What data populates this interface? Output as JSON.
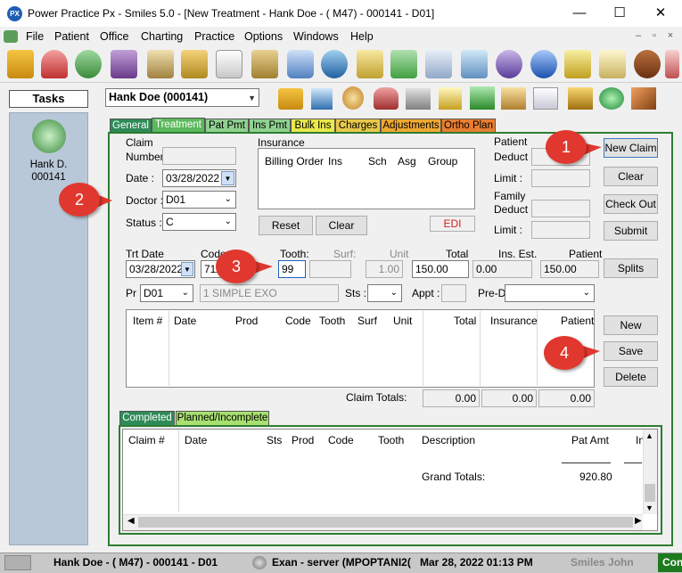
{
  "window": {
    "title": "Power Practice Px - Smiles 5.0 - [New Treatment - Hank Doe - ( M47) - 000141 - D01]",
    "app_icon_text": "PX",
    "min": "—",
    "max": "☐",
    "close": "✕"
  },
  "menu": [
    "File",
    "Patient",
    "Office",
    "Charting",
    "Practice",
    "Options",
    "Windows",
    "Help"
  ],
  "mdi_controls": [
    "–",
    "▫",
    "×"
  ],
  "tasks": {
    "title": "Tasks",
    "item_name": "Hank D.",
    "item_id": "000141"
  },
  "patient_select": {
    "value": "Hank Doe (000141)"
  },
  "tabs": [
    {
      "label": "General",
      "bg": "#2e8b57",
      "fg": "#ffffff"
    },
    {
      "label": "Treatment",
      "bg": "#5cb85c",
      "fg": "#ffffff"
    },
    {
      "label": "Pat Pmt",
      "bg": "#8fd18f",
      "fg": "#000000"
    },
    {
      "label": "Ins Pmt",
      "bg": "#8fd18f",
      "fg": "#000000"
    },
    {
      "label": "Bulk Ins",
      "bg": "#e8e84a",
      "fg": "#000000"
    },
    {
      "label": "Charges",
      "bg": "#e8c84a",
      "fg": "#000000"
    },
    {
      "label": "Adjustments",
      "bg": "#f0a830",
      "fg": "#000000"
    },
    {
      "label": "Ortho Plan",
      "bg": "#e87e30",
      "fg": "#000000"
    }
  ],
  "claim": {
    "section_label": "Claim",
    "number_label": "Number :",
    "number_value": "",
    "date_label": "Date :",
    "date_value": "03/28/2022",
    "doctor_label": "Doctor :",
    "doctor_value": "D01",
    "status_label": "Status :",
    "status_value": "C"
  },
  "insurance": {
    "section_label": "Insurance",
    "columns": [
      "Billing Order",
      "Ins",
      "Sch",
      "Asg",
      "Group"
    ],
    "reset": "Reset",
    "clear": "Clear",
    "edi": "EDI"
  },
  "deductibles": {
    "patient": "Patient",
    "deduct": "Deduct :",
    "limit": "Limit :",
    "family": "Family",
    "fam_deduct": "Deduct :",
    "fam_limit": "Limit :"
  },
  "side_buttons_top": [
    "New Claim",
    "Clear",
    "Check Out",
    "Submit"
  ],
  "entry": {
    "trt_date_label": "Trt Date",
    "trt_date_value": "03/28/2022",
    "code_label": "Code",
    "code_value": "711",
    "tooth_label": "Tooth:",
    "tooth_value": "99",
    "surf_label": "Surf:",
    "unit_label": "Unit",
    "unit_value": "1.00",
    "total_label": "Total",
    "total_value": "150.00",
    "ins_est_label": "Ins. Est.",
    "ins_est_value": "0.00",
    "patient_label": "Patient",
    "patient_value": "150.00",
    "pr_label": "Pr",
    "pr_value": "D01",
    "description": "1 SIMPLE EXO",
    "sts_label": "Sts :",
    "appt_label": "Appt :",
    "pred_label": "Pre-D",
    "splits": "Splits"
  },
  "items_table": {
    "columns": [
      "Item #",
      "Date",
      "Prod",
      "Code",
      "Tooth",
      "Surf",
      "Unit",
      "Total",
      "Insurance",
      "Patient"
    ],
    "claim_totals_label": "Claim Totals:",
    "totals": [
      "0.00",
      "0.00",
      "0.00"
    ]
  },
  "side_buttons_mid": [
    "New",
    "Save",
    "Delete"
  ],
  "bottom_tabs": [
    {
      "label": "Completed",
      "bg": "#2e8b57",
      "fg": "#ffffff"
    },
    {
      "label": "Planned/Incomplete",
      "bg": "#a8e070",
      "fg": "#000000"
    }
  ],
  "history_table": {
    "columns": [
      "Claim #",
      "Date",
      "Sts",
      "Prod",
      "Code",
      "Tooth",
      "Description",
      "Pat Amt",
      "In"
    ],
    "grand_totals_label": "Grand Totals:",
    "grand_total_value": "920.80"
  },
  "callouts": [
    "1",
    "2",
    "3",
    "4"
  ],
  "statusbar": {
    "patient": "Hank Doe - ( M47) - 000141 - D01",
    "server": "Exan - server (MPOPTANI2(",
    "datetime": "Mar 28, 2022 01:13 PM",
    "user": "Smiles John",
    "con": "Con"
  },
  "colors": {
    "green_border": "#2e7d32",
    "callout": "#e0382e",
    "tasks_panel": "#b8c8d8"
  }
}
